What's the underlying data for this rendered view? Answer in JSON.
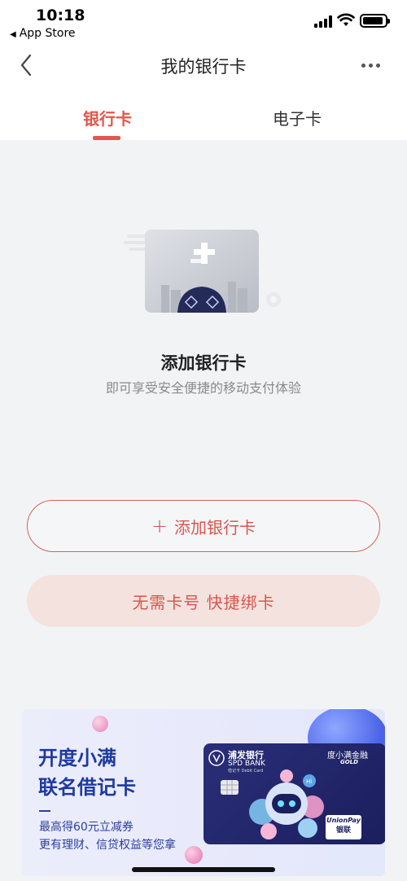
{
  "status_bar": {
    "time": "10:18",
    "back_app": "App Store"
  },
  "nav": {
    "title": "我的银行卡"
  },
  "tabs": [
    {
      "label": "银行卡",
      "active": true
    },
    {
      "label": "电子卡",
      "active": false
    }
  ],
  "empty_state": {
    "title": "添加银行卡",
    "subtitle": "即可享受安全便捷的移动支付体验"
  },
  "buttons": {
    "add_icon": "+",
    "add_label": "添加银行卡",
    "quick_label": "无需卡号 快捷绑卡"
  },
  "banner": {
    "line1": "开度小满",
    "line2": "联名借记卡",
    "sub1": "最高得60元立减券",
    "sub2": "更有理财、信贷权益等您拿",
    "card": {
      "bank_name": "浦发银行",
      "bank_en": "SPD BANK",
      "bank_sub": "借记卡 Debit Card",
      "brand": "度小满金融",
      "brand_tier": "GOLD",
      "network_en": "UnionPay",
      "network_cn": "银联",
      "robot_greeting": "Hi"
    }
  },
  "colors": {
    "accent": "#e2564c",
    "quick_bg": "#f4e2df",
    "banner_text": "#1e3aa0"
  },
  "icons": {
    "back": "chevron-left-icon",
    "more": "more-dots-icon"
  }
}
